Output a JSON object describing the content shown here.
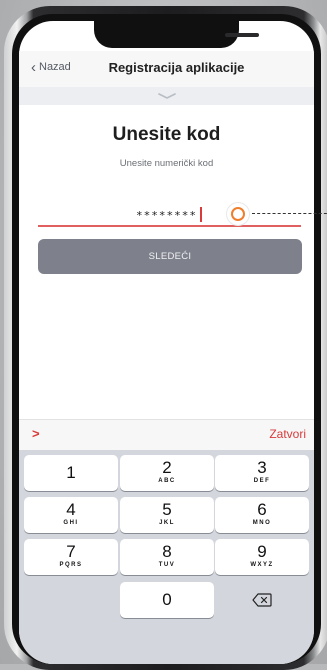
{
  "navbar": {
    "back_label": "Nazad",
    "title": "Registracija aplikacije"
  },
  "form": {
    "heading": "Unesite kod",
    "subheading": "Unesite numerički kod",
    "code_value": "********",
    "next_button": "SLEDEĆI"
  },
  "accessory": {
    "arrow": ">",
    "close_label": "Zatvori"
  },
  "keyboard": {
    "keys": [
      {
        "num": "1",
        "letters": ""
      },
      {
        "num": "2",
        "letters": "ABC"
      },
      {
        "num": "3",
        "letters": "DEF"
      },
      {
        "num": "4",
        "letters": "GHI"
      },
      {
        "num": "5",
        "letters": "JKL"
      },
      {
        "num": "6",
        "letters": "MNO"
      },
      {
        "num": "7",
        "letters": "PQRS"
      },
      {
        "num": "8",
        "letters": "TUV"
      },
      {
        "num": "9",
        "letters": "WXYZ"
      },
      {
        "num": "0",
        "letters": ""
      }
    ],
    "backspace_icon": "backspace-icon"
  },
  "colors": {
    "accent_red": "#d93a3a",
    "button_gray": "#7e818b",
    "marker_orange": "#ef7e2c"
  }
}
